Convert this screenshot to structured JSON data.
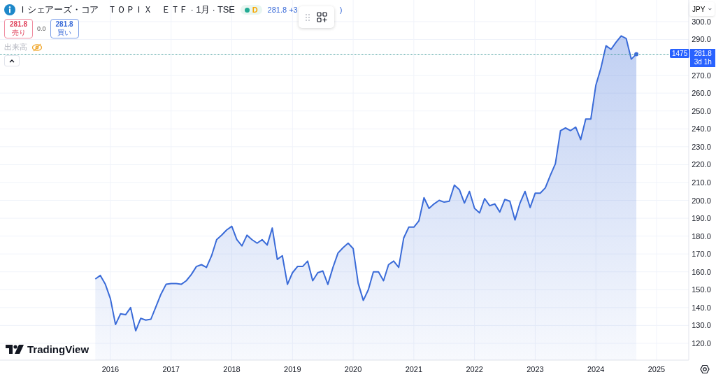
{
  "legend": {
    "title": "Ｉシェアーズ・コア　ＴＯＰＩＸ　ＥＴＦ · 1月 · TSE",
    "market_open": true,
    "delay_badge": "D",
    "price_text": "281.8 +3",
    "price_text_tail": ")",
    "sell": {
      "price": "281.8",
      "label": "売り"
    },
    "spread": "0.0",
    "buy": {
      "price": "281.8",
      "label": "買い"
    },
    "volume_label": "出来高",
    "volume_hidden": true
  },
  "currency": "JPY",
  "last_price": {
    "bar_count": "1475",
    "price": "281.8",
    "countdown": "3d 1h"
  },
  "logo": "TradingView",
  "chart_data": {
    "type": "area",
    "x": [
      2015.75,
      2015.833,
      2015.917,
      2016,
      2016.083,
      2016.167,
      2016.25,
      2016.333,
      2016.417,
      2016.5,
      2016.583,
      2016.667,
      2016.75,
      2016.833,
      2016.917,
      2017,
      2017.083,
      2017.167,
      2017.25,
      2017.333,
      2017.417,
      2017.5,
      2017.583,
      2017.667,
      2017.75,
      2017.833,
      2017.917,
      2018,
      2018.083,
      2018.167,
      2018.25,
      2018.333,
      2018.417,
      2018.5,
      2018.583,
      2018.667,
      2018.75,
      2018.833,
      2018.917,
      2019,
      2019.083,
      2019.167,
      2019.25,
      2019.333,
      2019.417,
      2019.5,
      2019.583,
      2019.667,
      2019.75,
      2019.833,
      2019.917,
      2020,
      2020.083,
      2020.167,
      2020.25,
      2020.333,
      2020.417,
      2020.5,
      2020.583,
      2020.667,
      2020.75,
      2020.833,
      2020.917,
      2021,
      2021.083,
      2021.167,
      2021.25,
      2021.333,
      2021.417,
      2021.5,
      2021.583,
      2021.667,
      2021.75,
      2021.833,
      2021.917,
      2022,
      2022.083,
      2022.167,
      2022.25,
      2022.333,
      2022.417,
      2022.5,
      2022.583,
      2022.667,
      2022.75,
      2022.833,
      2022.917,
      2023,
      2023.083,
      2023.167,
      2023.25,
      2023.333,
      2023.417,
      2023.5,
      2023.583,
      2023.667,
      2023.75,
      2023.833,
      2023.917,
      2024,
      2024.083,
      2024.167,
      2024.25,
      2024.333,
      2024.417,
      2024.5,
      2024.583,
      2024.667
    ],
    "series": [
      {
        "color": "#3a6bd8",
        "values": [
          156,
          158,
          153,
          145,
          130.5,
          136.5,
          136,
          140,
          127,
          134,
          133,
          133.5,
          140.5,
          147.5,
          153,
          153.5,
          153.5,
          153,
          155,
          158.5,
          163,
          164,
          162.5,
          169,
          178,
          180.5,
          183.5,
          185.5,
          178,
          174.5,
          180.5,
          178,
          176,
          178,
          175,
          184.5,
          167,
          169,
          153,
          159.5,
          163,
          163,
          166,
          155,
          159.5,
          160.5,
          153,
          162.5,
          170.5,
          173.5,
          176,
          173,
          153.5,
          144,
          150,
          160,
          160,
          155,
          164,
          166,
          162.5,
          179,
          185,
          185,
          188.5,
          201.5,
          195.5,
          198,
          200,
          199,
          199.5,
          208.5,
          206,
          198.5,
          205,
          195.5,
          193,
          201,
          197,
          198,
          193.5,
          200.5,
          199.5,
          189,
          198.5,
          205,
          196,
          204,
          204,
          207,
          214,
          220.5,
          239,
          240.5,
          239,
          241,
          234,
          245.5,
          245.5,
          264.5,
          274,
          286.5,
          284.5,
          288.5,
          292,
          290.5,
          279,
          281.8
        ]
      }
    ],
    "xlim": [
      2014.18,
      2025.53
    ],
    "ylim": [
      110.6,
      312.1
    ],
    "grid": true,
    "xticks": [
      {
        "value": 2016,
        "label": "2016"
      },
      {
        "value": 2017,
        "label": "2017"
      },
      {
        "value": 2018,
        "label": "2018"
      },
      {
        "value": 2019,
        "label": "2019"
      },
      {
        "value": 2020,
        "label": "2020"
      },
      {
        "value": 2021,
        "label": "2021"
      },
      {
        "value": 2022,
        "label": "2022"
      },
      {
        "value": 2023,
        "label": "2023"
      },
      {
        "value": 2024,
        "label": "2024"
      },
      {
        "value": 2025,
        "label": "2025"
      }
    ],
    "yticks": [
      {
        "value": 120,
        "label": "120.0"
      },
      {
        "value": 130,
        "label": "130.0"
      },
      {
        "value": 140,
        "label": "140.0"
      },
      {
        "value": 150,
        "label": "150.0"
      },
      {
        "value": 160,
        "label": "160.0"
      },
      {
        "value": 170,
        "label": "170.0"
      },
      {
        "value": 180,
        "label": "180.0"
      },
      {
        "value": 190,
        "label": "190.0"
      },
      {
        "value": 200,
        "label": "200.0"
      },
      {
        "value": 210,
        "label": "210.0"
      },
      {
        "value": 220,
        "label": "220.0"
      },
      {
        "value": 230,
        "label": "230.0"
      },
      {
        "value": 240,
        "label": "240.0"
      },
      {
        "value": 250,
        "label": "250.0"
      },
      {
        "value": 260,
        "label": "260.0"
      },
      {
        "value": 270,
        "label": "270.0"
      },
      {
        "value": 290,
        "label": "290.0"
      },
      {
        "value": 300,
        "label": "300.0"
      }
    ]
  }
}
